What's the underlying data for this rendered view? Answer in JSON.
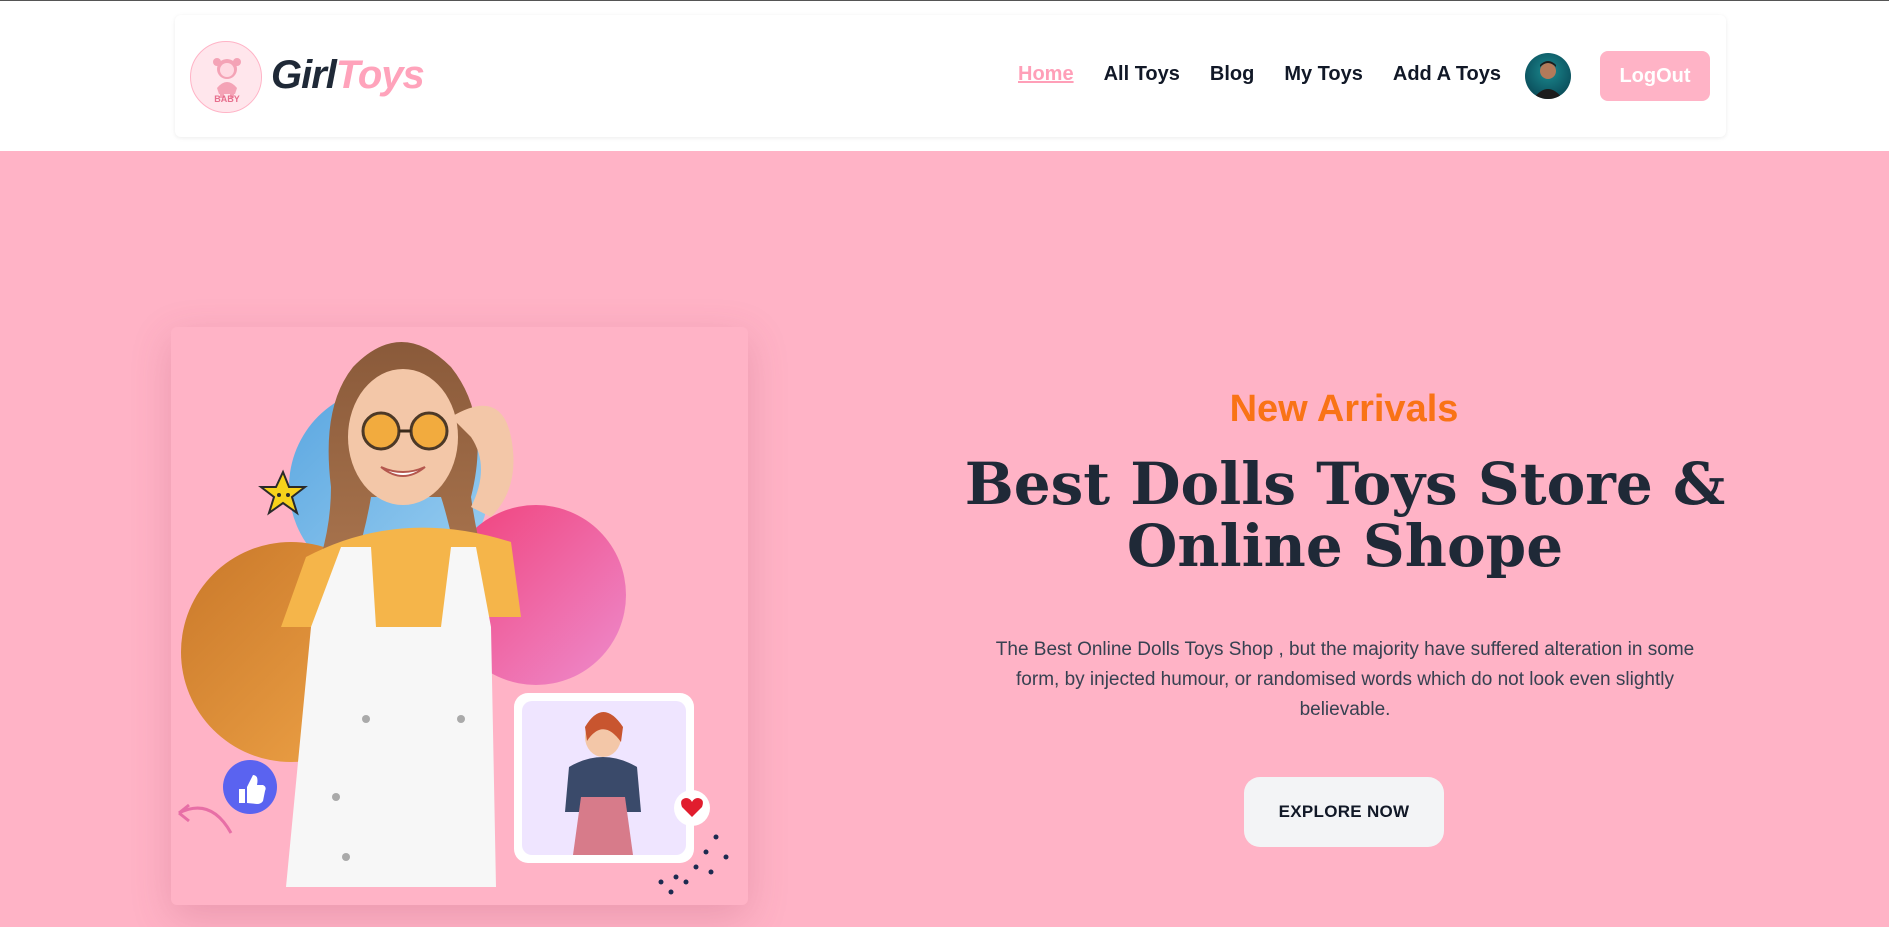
{
  "brand": {
    "part1": "Girl",
    "part2": "Toys",
    "badge_text": "BABY"
  },
  "nav": {
    "items": [
      {
        "label": "Home",
        "active": true
      },
      {
        "label": "All Toys"
      },
      {
        "label": "Blog"
      },
      {
        "label": "My Toys"
      },
      {
        "label": "Add A Toys"
      }
    ],
    "logout_label": "LogOut"
  },
  "hero": {
    "eyebrow": "New Arrivals",
    "title_line1": "Best Dolls Toys Store &",
    "title_line2": "Online Shope",
    "description": "The Best Online Dolls Toys Shop , but the majority have suffered alteration in some form, by injected humour, or randomised words which do not look even slightly believable.",
    "cta_label": "EXPLORE NOW"
  },
  "colors": {
    "brand_pink": "#ffb3c6",
    "accent_orange": "#f97316",
    "dark_text": "#1f2937"
  },
  "icons": [
    "doll-logo-icon",
    "user-avatar",
    "like-icon",
    "heart-icon",
    "star-sticker-icon",
    "arrow-doodle-icon"
  ]
}
